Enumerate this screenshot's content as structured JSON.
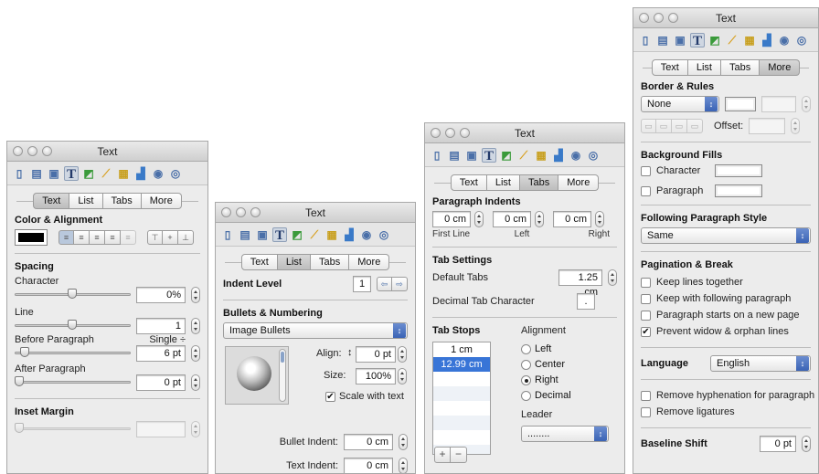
{
  "title": "Text",
  "toolbar_icons": [
    "layout-icon",
    "document-icon",
    "wrap-icon",
    "text-icon",
    "graphic-icon",
    "ruler-icon",
    "table-icon",
    "chart-icon",
    "link-icon",
    "quicktime-icon"
  ],
  "tab_labels": {
    "text": "Text",
    "list": "List",
    "tabs": "Tabs",
    "more": "More"
  },
  "w1": {
    "color_alignment": "Color & Alignment",
    "spacing": "Spacing",
    "character": "Character",
    "char_val": "0%",
    "line": "Line",
    "line_val": "1",
    "line_mode": "Single ÷",
    "before": "Before Paragraph",
    "before_val": "6 pt",
    "after": "After Paragraph",
    "after_val": "0 pt",
    "inset": "Inset Margin",
    "text_color": "#000000"
  },
  "w2": {
    "indent_level": "Indent Level",
    "indent_val": "1",
    "bullets": "Bullets & Numbering",
    "bullet_type": "Image Bullets",
    "align": "Align:",
    "align_val": "0 pt",
    "size": "Size:",
    "size_val": "100%",
    "scale": "Scale with text",
    "bullet_indent": "Bullet Indent:",
    "bullet_indent_val": "0 cm",
    "text_indent": "Text Indent:",
    "text_indent_val": "0 cm"
  },
  "w3": {
    "para_indents": "Paragraph Indents",
    "first_val": "0 cm",
    "left_val": "0 cm",
    "right_val": "0 cm",
    "first": "First Line",
    "left": "Left",
    "right": "Right",
    "tab_settings": "Tab Settings",
    "default_tabs": "Default Tabs",
    "default_val": "1.25 cm",
    "decimal_char": "Decimal Tab Character",
    "decimal_val": ".",
    "tab_stops": "Tab Stops",
    "stops": [
      "1 cm",
      "12.99 cm"
    ],
    "alignment": "Alignment",
    "align_opts": [
      "Left",
      "Center",
      "Right",
      "Decimal"
    ],
    "leader": "Leader",
    "leader_val": "........",
    "add": "+",
    "remove": "−"
  },
  "w4": {
    "border_rules": "Border & Rules",
    "border_style": "None",
    "offset": "Offset:",
    "bg_fills": "Background Fills",
    "character": "Character",
    "paragraph": "Paragraph",
    "following": "Following Paragraph Style",
    "following_val": "Same",
    "pagination": "Pagination & Break",
    "keep_lines": "Keep lines together",
    "keep_next": "Keep with following paragraph",
    "new_page": "Paragraph starts on a new page",
    "widow": "Prevent widow & orphan lines",
    "language": "Language",
    "language_val": "English",
    "hyphen": "Remove hyphenation for paragraph",
    "ligatures": "Remove ligatures",
    "baseline": "Baseline Shift",
    "baseline_val": "0 pt"
  }
}
